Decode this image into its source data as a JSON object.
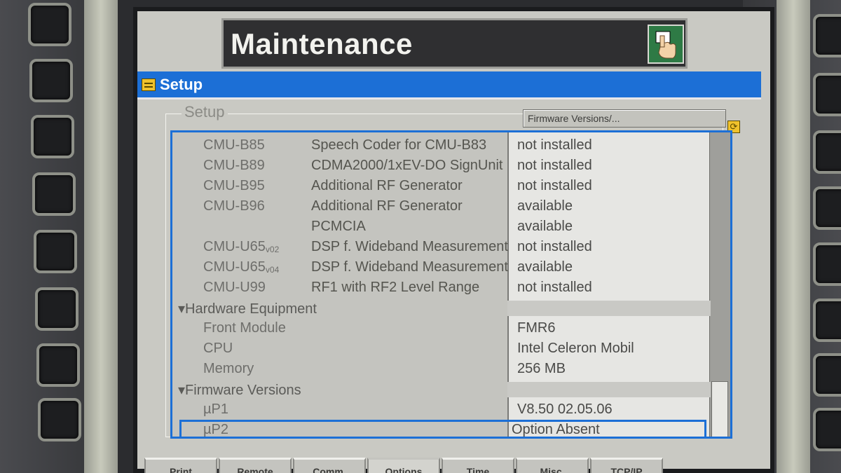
{
  "window": {
    "title": "Maintenance",
    "panel_title": "Setup"
  },
  "frame": {
    "label": "Setup",
    "dropdown_value": "Firmware Versions/..."
  },
  "options_rows": [
    {
      "code": "CMU-B85",
      "description": "Speech Coder for CMU-B83",
      "status": "not installed"
    },
    {
      "code": "CMU-B89",
      "description": "CDMA2000/1xEV-DO SignUnit",
      "status": "not installed"
    },
    {
      "code": "CMU-B95",
      "description": "Additional RF Generator",
      "status": "not installed"
    },
    {
      "code": "CMU-B96",
      "description": "Additional RF Generator",
      "status": "available"
    },
    {
      "code": "",
      "description": "PCMCIA",
      "status": "available"
    },
    {
      "code": "CMU-U65",
      "code_suffix": "v02",
      "description": "DSP f. Wideband Measurement",
      "status": "not installed"
    },
    {
      "code": "CMU-U65",
      "code_suffix": "v04",
      "description": "DSP f. Wideband Measurement",
      "status": "available"
    },
    {
      "code": "CMU-U99",
      "description": "RF1 with RF2 Level Range",
      "status": "not installed"
    }
  ],
  "hardware": {
    "label": "Hardware Equipment",
    "rows": [
      {
        "name": "Front Module",
        "value": "FMR6"
      },
      {
        "name": "CPU",
        "value": "Intel Celeron Mobil"
      },
      {
        "name": "Memory",
        "value": "256 MB"
      }
    ]
  },
  "firmware": {
    "label": "Firmware Versions",
    "rows": [
      {
        "name": "µP1",
        "value": "V8.50  02.05.06"
      },
      {
        "name": "µP2",
        "value": "Option Absent"
      }
    ]
  },
  "tabs": [
    "Print",
    "Remote",
    "Comm.",
    "Options",
    "Time",
    "Misc.",
    "TCP/IP"
  ],
  "active_tab": "Options",
  "colors": {
    "accent": "#1c6fd6",
    "title_bar": "#2f2f31",
    "hand_button": "#2e7a45",
    "icon_yellow": "#f0c22c"
  }
}
